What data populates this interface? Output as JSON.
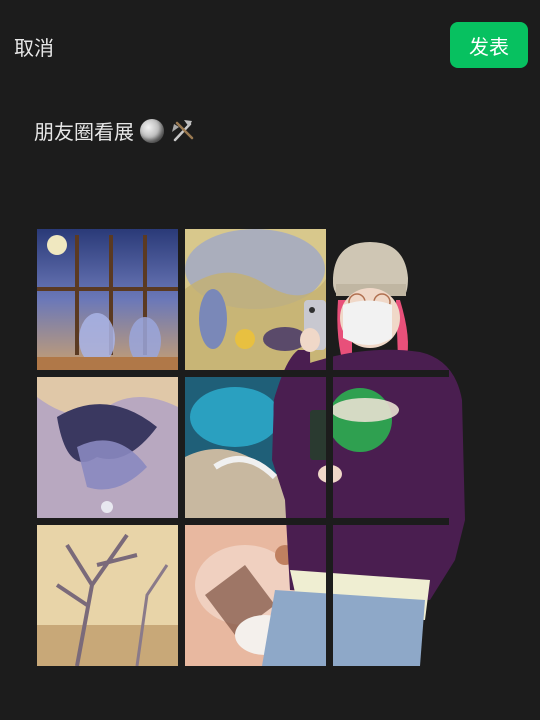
{
  "header": {
    "cancel_label": "取消",
    "publish_label": "发表"
  },
  "post": {
    "caption": "朋友圈看展",
    "emojis": [
      "moon-ball-icon",
      "hammer-pick-icon"
    ]
  },
  "images": [
    "artwork-window-figures",
    "artwork-grove-figures",
    "artwork-blue-swirl",
    "artwork-teal-wave",
    "artwork-person-cutout-overlay",
    "artwork-bare-tree",
    "artwork-pink-abstract"
  ],
  "colors": {
    "background": "#1c1c1c",
    "publish_button": "#07c160",
    "text": "#e6e6e6"
  }
}
